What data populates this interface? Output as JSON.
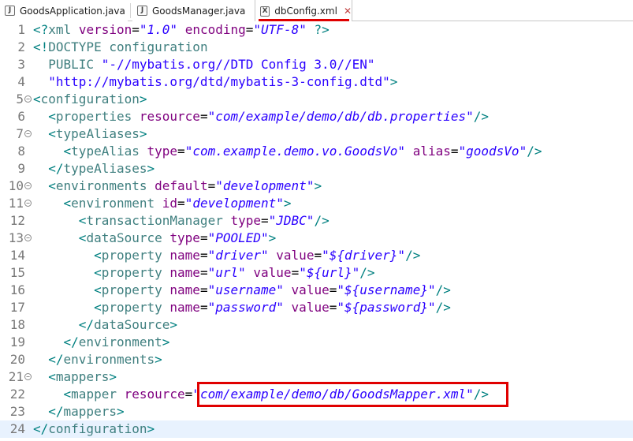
{
  "tabs": [
    {
      "label": "GoodsApplication.java",
      "icon": "java-file-icon",
      "icon_glyph": "J",
      "active": false
    },
    {
      "label": "GoodsManager.java",
      "icon": "java-file-icon",
      "icon_glyph": "J",
      "active": false
    },
    {
      "label": "dbConfig.xml",
      "icon": "xml-file-icon",
      "icon_glyph": "X",
      "active": true
    }
  ],
  "close_glyph": "✕",
  "colors": {
    "tag": "#3f7f7f",
    "attribute": "#7f007f",
    "value": "#2a00ff",
    "highlight": "#e00000",
    "current_line": "#e8f2fe"
  },
  "editor": {
    "current_line": 24,
    "highlighted_text": "\"com/example/demo/db/GoodsMapper.xml\"",
    "lines": [
      {
        "n": "1",
        "fold": false,
        "code": "<?xml version=\"1.0\" encoding=\"UTF-8\" ?>"
      },
      {
        "n": "2",
        "fold": false,
        "code": "<!DOCTYPE configuration"
      },
      {
        "n": "3",
        "fold": false,
        "code": "  PUBLIC \"-//mybatis.org//DTD Config 3.0//EN\""
      },
      {
        "n": "4",
        "fold": false,
        "code": "  \"http://mybatis.org/dtd/mybatis-3-config.dtd\">"
      },
      {
        "n": "5",
        "fold": true,
        "code": "<configuration>"
      },
      {
        "n": "6",
        "fold": false,
        "code": "  <properties resource=\"com/example/demo/db/db.properties\"/>"
      },
      {
        "n": "7",
        "fold": true,
        "code": "  <typeAliases>"
      },
      {
        "n": "8",
        "fold": false,
        "code": "    <typeAlias type=\"com.example.demo.vo.GoodsVo\" alias=\"goodsVo\"/>"
      },
      {
        "n": "9",
        "fold": false,
        "code": "  </typeAliases>"
      },
      {
        "n": "10",
        "fold": true,
        "code": "  <environments default=\"development\">"
      },
      {
        "n": "11",
        "fold": true,
        "code": "    <environment id=\"development\">"
      },
      {
        "n": "12",
        "fold": false,
        "code": "      <transactionManager type=\"JDBC\"/>"
      },
      {
        "n": "13",
        "fold": true,
        "code": "      <dataSource type=\"POOLED\">"
      },
      {
        "n": "14",
        "fold": false,
        "code": "        <property name=\"driver\" value=\"${driver}\"/>"
      },
      {
        "n": "15",
        "fold": false,
        "code": "        <property name=\"url\" value=\"${url}\"/>"
      },
      {
        "n": "16",
        "fold": false,
        "code": "        <property name=\"username\" value=\"${username}\"/>"
      },
      {
        "n": "17",
        "fold": false,
        "code": "        <property name=\"password\" value=\"${password}\"/>"
      },
      {
        "n": "18",
        "fold": false,
        "code": "      </dataSource>"
      },
      {
        "n": "19",
        "fold": false,
        "code": "    </environment>"
      },
      {
        "n": "20",
        "fold": false,
        "code": "  </environments>"
      },
      {
        "n": "21",
        "fold": true,
        "code": "  <mappers>"
      },
      {
        "n": "22",
        "fold": false,
        "code": "    <mapper resource=\"com/example/demo/db/GoodsMapper.xml\"/>"
      },
      {
        "n": "23",
        "fold": false,
        "code": "  </mappers>"
      },
      {
        "n": "24",
        "fold": false,
        "code": "</configuration>"
      }
    ]
  }
}
